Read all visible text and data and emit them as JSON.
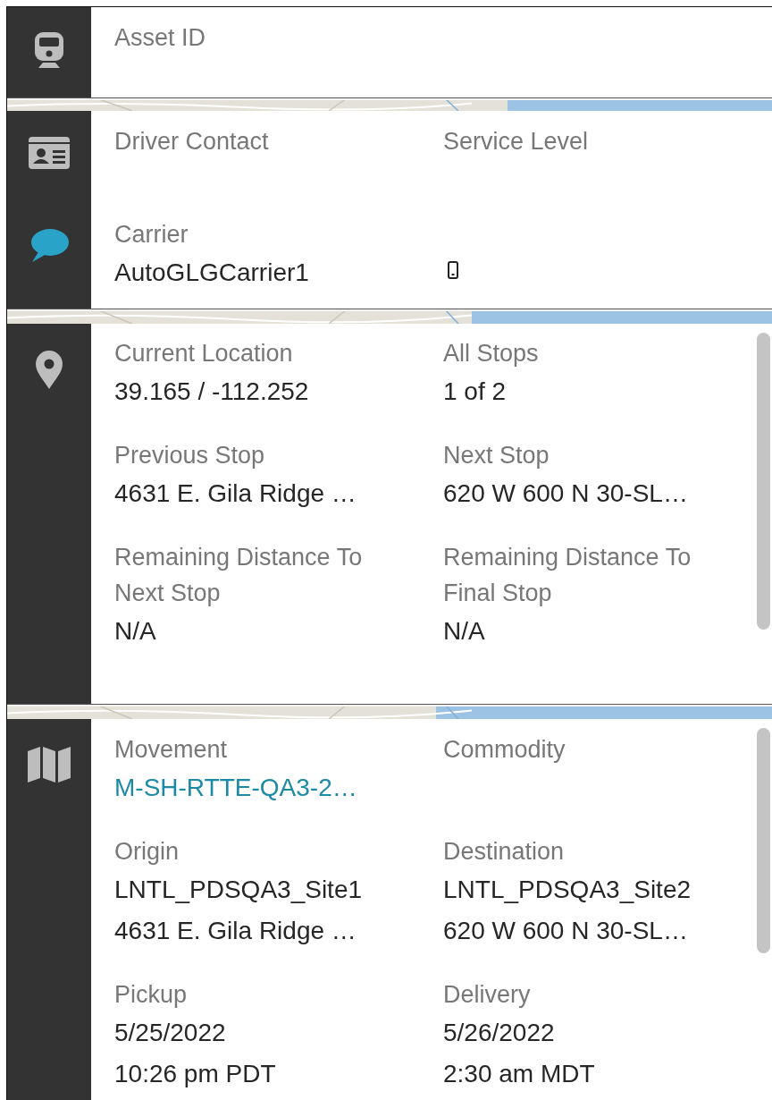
{
  "panels": [
    {
      "icons": [
        {
          "kind": "train",
          "active": false
        }
      ],
      "scrollbar": false,
      "fields": [
        {
          "kind": "text",
          "label": "Asset ID"
        }
      ]
    },
    {
      "icons": [
        {
          "kind": "id-card",
          "active": false
        },
        {
          "kind": "chat",
          "active": true
        }
      ],
      "scrollbar": false,
      "fields": [
        {
          "kind": "text",
          "label": "Driver Contact"
        },
        {
          "kind": "text",
          "label": "Service Level"
        },
        {
          "kind": "text",
          "label": "Carrier",
          "values": [
            {
              "kind": "text",
              "text": "AutoGLGCarrier1"
            }
          ]
        },
        {
          "kind": "phone"
        }
      ]
    },
    {
      "icons": [
        {
          "kind": "pin",
          "active": false
        }
      ],
      "scrollbar": true,
      "fields": [
        {
          "kind": "text",
          "label": "Current Location",
          "values": [
            {
              "kind": "text",
              "text": "39.165 / -112.252"
            }
          ]
        },
        {
          "kind": "text",
          "label": "All Stops",
          "values": [
            {
              "kind": "text",
              "text": "1 of 2"
            }
          ]
        },
        {
          "kind": "text",
          "label": "Previous Stop",
          "values": [
            {
              "kind": "text",
              "text": "4631 E. Gila Ridge …"
            }
          ]
        },
        {
          "kind": "text",
          "label": "Next Stop",
          "values": [
            {
              "kind": "text",
              "text": "620 W 600 N 30-SL…"
            }
          ]
        },
        {
          "kind": "text",
          "label": "Remaining Distance To Next Stop",
          "values": [
            {
              "kind": "text",
              "text": "N/A"
            }
          ]
        },
        {
          "kind": "text",
          "label": "Remaining Distance To Final Stop",
          "values": [
            {
              "kind": "text",
              "text": "N/A"
            }
          ]
        }
      ]
    },
    {
      "icons": [
        {
          "kind": "map",
          "active": false
        }
      ],
      "scrollbar": true,
      "fields": [
        {
          "kind": "text",
          "label": "Movement",
          "values": [
            {
              "kind": "link",
              "text": "M-SH-RTTE-QA3-2…"
            }
          ]
        },
        {
          "kind": "text",
          "label": "Commodity"
        },
        {
          "kind": "text",
          "label": "Origin",
          "values": [
            {
              "kind": "text",
              "text": "LNTL_PDSQA3_Site1"
            },
            {
              "kind": "text",
              "text": "4631 E. Gila Ridge …"
            }
          ]
        },
        {
          "kind": "text",
          "label": "Destination",
          "values": [
            {
              "kind": "text",
              "text": "LNTL_PDSQA3_Site2"
            },
            {
              "kind": "text",
              "text": "620 W 600 N 30-SL…"
            }
          ]
        },
        {
          "kind": "text",
          "label": "Pickup",
          "values": [
            {
              "kind": "text",
              "text": "5/25/2022"
            },
            {
              "kind": "text",
              "text": "10:26 pm PDT"
            }
          ]
        },
        {
          "kind": "text",
          "label": "Delivery",
          "values": [
            {
              "kind": "text",
              "text": "5/26/2022"
            },
            {
              "kind": "text",
              "text": "2:30 am MDT"
            }
          ]
        }
      ]
    }
  ]
}
